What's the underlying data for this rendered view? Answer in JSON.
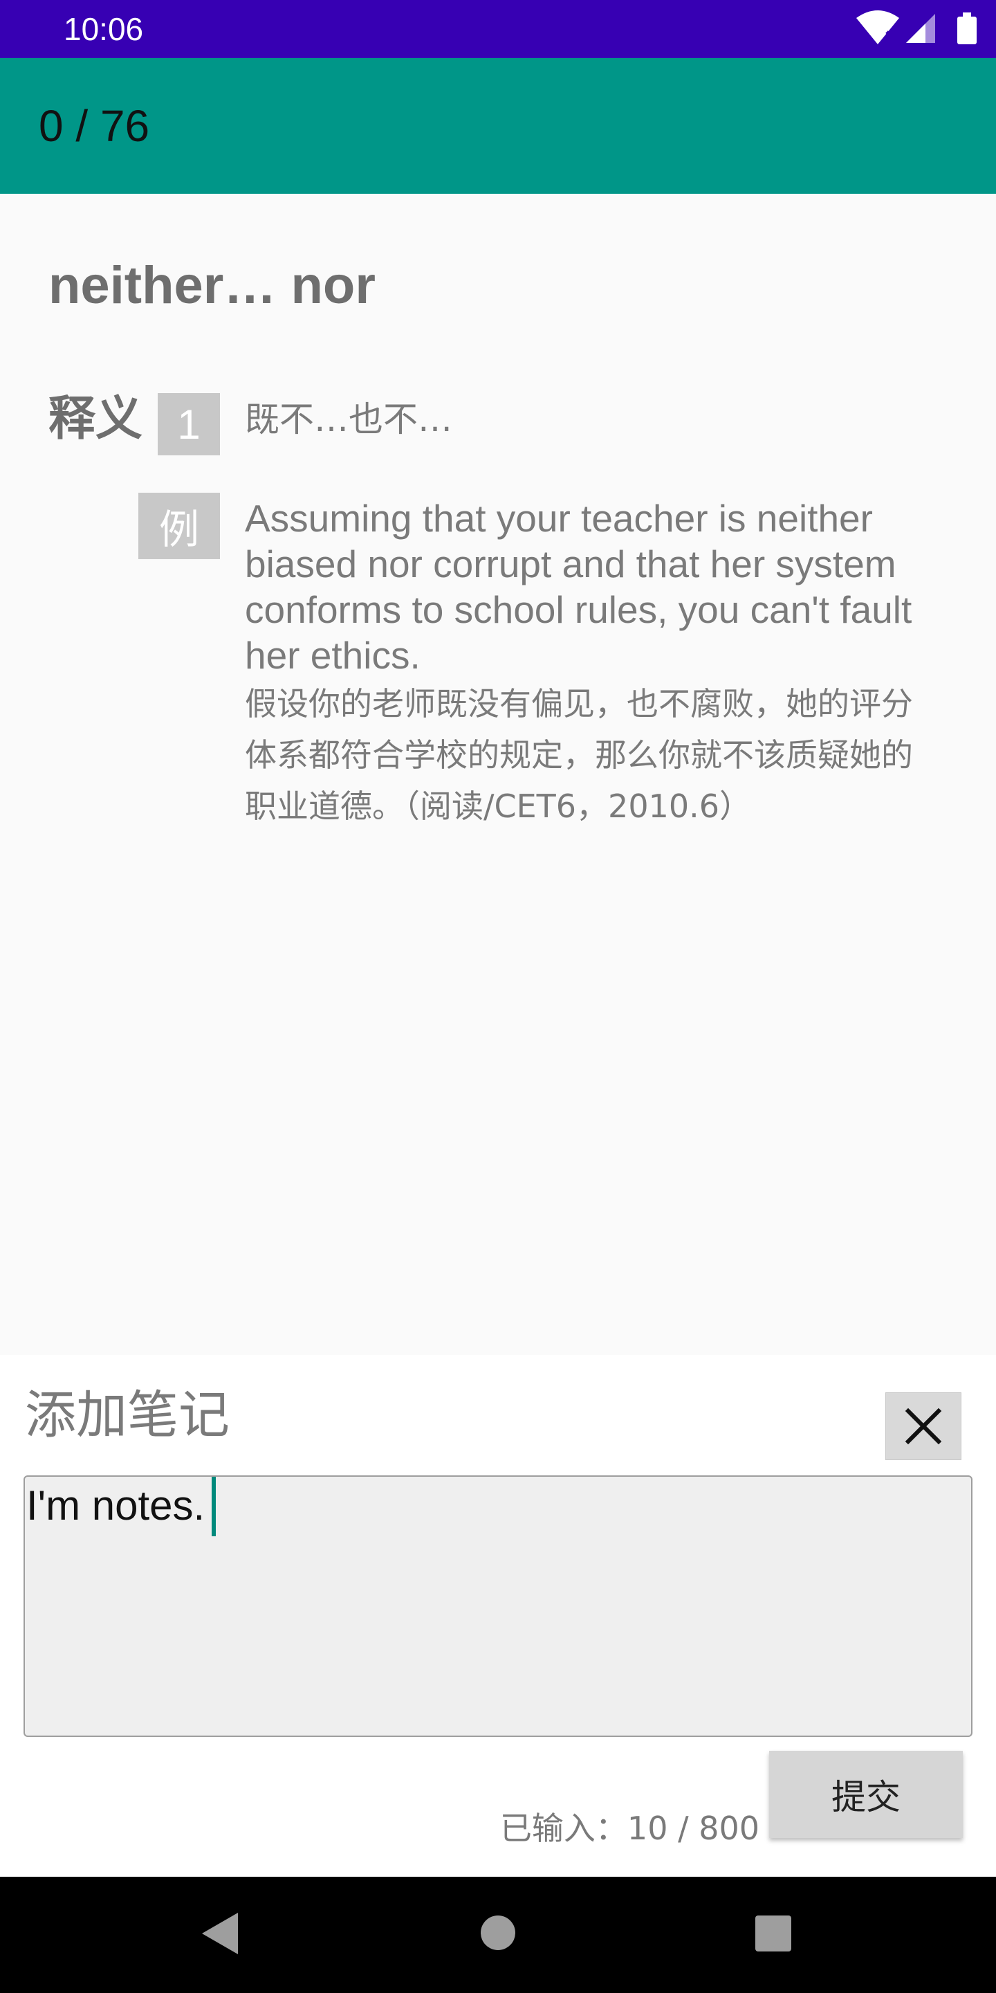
{
  "status_bar": {
    "time": "10:06",
    "icons": [
      "wifi-icon",
      "signal-icon",
      "battery-icon"
    ]
  },
  "app_bar": {
    "progress": "0 / 76"
  },
  "entry": {
    "word": "neither… nor",
    "definition_label": "释义",
    "definitions": [
      {
        "number": "1",
        "text": "既不…也不…",
        "example_badge": "例",
        "example_en": "Assuming that your teacher is neither biased nor corrupt and that her system conforms to school rules, you can't fault her ethics.",
        "example_zh": "假设你的老师既没有偏见，也不腐败，她的评分体系都符合学校的规定，那么你就不该质疑她的职业道德。（阅读/CET6，2010.6）"
      }
    ]
  },
  "note_panel": {
    "title": "添加笔记",
    "close_icon": "close-icon",
    "input_value": "I'm notes.",
    "char_count": "已输入：10 / 800",
    "submit_label": "提交"
  },
  "nav_bar": {
    "icons": [
      "back-icon",
      "home-icon",
      "recents-icon"
    ]
  },
  "colors": {
    "status_bar": "#3700b3",
    "app_bar": "#009688",
    "background": "#fafafa",
    "badge": "#c8c8c8",
    "cursor": "#00897b"
  }
}
